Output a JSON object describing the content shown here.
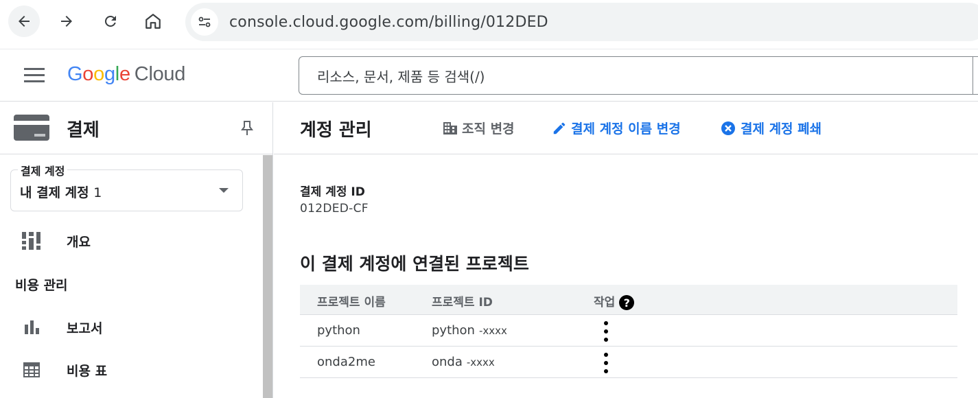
{
  "browser": {
    "url": "console.cloud.google.com/billing/012DED",
    "icons": [
      "back-arrow-icon",
      "forward-arrow-icon",
      "reload-icon",
      "home-icon",
      "site-info-icon"
    ]
  },
  "header": {
    "logo_google": "Google",
    "logo_cloud": "Cloud",
    "search_placeholder": "리소스, 문서, 제품 등 검색(/)"
  },
  "sidebar": {
    "title": "결제",
    "account_select": {
      "label": "결제 계정",
      "value": "내 결제 계정",
      "value_num": "1"
    },
    "items": [
      {
        "label": "개요",
        "icon": "overview-icon"
      },
      {
        "label": "보고서",
        "icon": "bar-chart-icon"
      },
      {
        "label": "비용 표",
        "icon": "table-icon"
      }
    ],
    "section_cost": "비용 관리"
  },
  "main": {
    "title": "계정 관리",
    "actions": {
      "org_change": "조직 변경",
      "rename": "결제 계정 이름 변경",
      "close": "결제 계정 폐쇄"
    },
    "account_id_label": "결제 계정 ID",
    "account_id_value": "012DED-CF",
    "projects_title": "이 결제 계정에 연결된 프로젝트",
    "table": {
      "headers": [
        "프로젝트 이름",
        "프로젝트 ID",
        "작업"
      ],
      "rows": [
        {
          "name": "python",
          "id": "python",
          "id_suffix": "-xxxx"
        },
        {
          "name": "onda2me",
          "id": "onda",
          "id_suffix": "-xxxx"
        }
      ]
    }
  },
  "colors": {
    "link_blue": "#1a73e8",
    "text_primary": "#202124",
    "text_secondary": "#5f6368"
  }
}
